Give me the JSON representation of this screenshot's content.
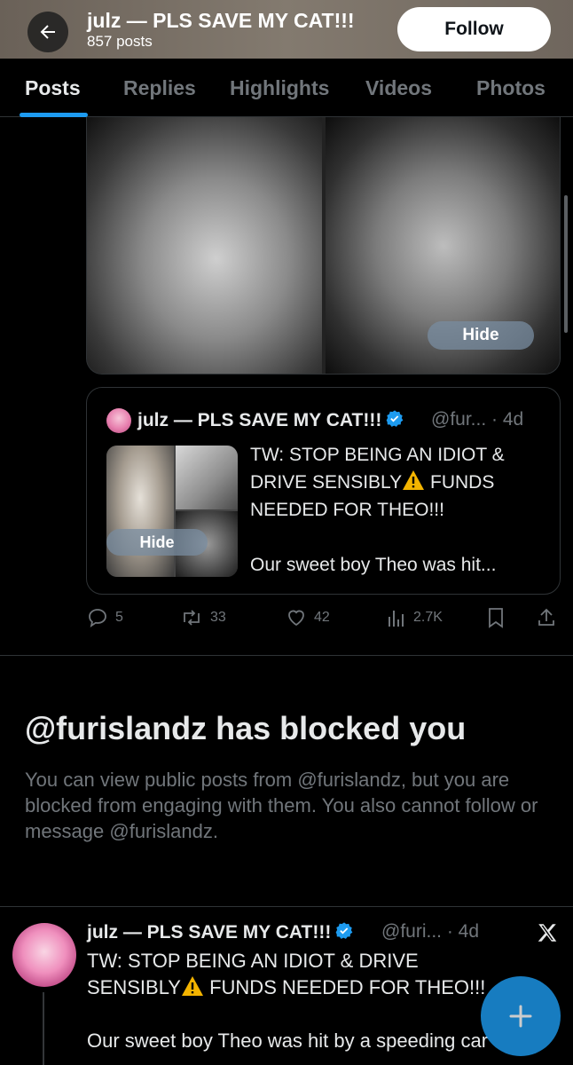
{
  "header": {
    "title": "julz — PLS SAVE MY CAT!!!",
    "post_count": "857 posts",
    "follow_label": "Follow"
  },
  "tabs": [
    {
      "label": "Posts",
      "active": true
    },
    {
      "label": "Replies",
      "active": false
    },
    {
      "label": "Highlights",
      "active": false
    },
    {
      "label": "Videos",
      "active": false
    },
    {
      "label": "Photos",
      "active": false
    }
  ],
  "media": {
    "hide_label": "Hide"
  },
  "quote": {
    "name": "julz — PLS SAVE MY CAT!!!",
    "handle_time": "@fur... · 4d",
    "hide_label": "Hide",
    "text_line1": "TW: STOP BEING AN IDIOT &",
    "text_line2a": "DRIVE SENSIBLY",
    "text_line2b": " FUNDS",
    "text_line3": "NEEDED FOR THEO!!!",
    "text_line4": "Our sweet boy Theo was hit..."
  },
  "actions": {
    "replies": "5",
    "reposts": "33",
    "likes": "42",
    "views": "2.7K"
  },
  "blocked": {
    "title": "@furislandz has blocked you",
    "body": "You can view public posts from @furislandz, but you are blocked from engaging with them. You also cannot follow or message @furislandz."
  },
  "post": {
    "name": "julz — PLS SAVE MY CAT!!!",
    "handle_time": "@furi... · 4d",
    "line1": "TW: STOP BEING AN IDIOT & DRIVE",
    "line2a": "SENSIBLY",
    "line2b": " FUNDS NEEDED FOR THEO!!!",
    "line3": "Our sweet boy Theo was hit by a speeding car"
  },
  "colors": {
    "accent": "#1d9bf0",
    "muted": "#71767b",
    "background": "#000000"
  }
}
